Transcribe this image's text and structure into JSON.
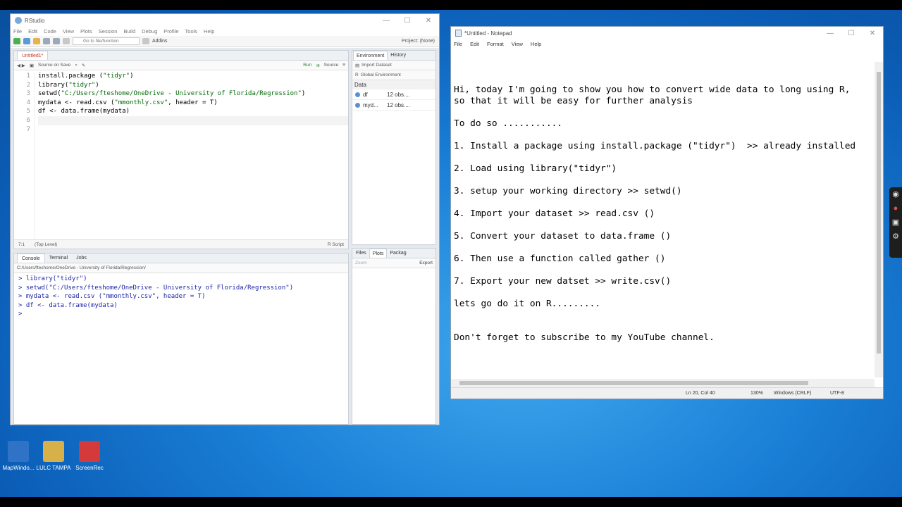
{
  "desktop": {
    "icons": [
      {
        "label": "MapWindo...",
        "color": "#2f73c7"
      },
      {
        "label": "LULC TAMPA",
        "color": "#d8b04a"
      },
      {
        "label": "ScreenRec",
        "color": "#d53a3a"
      }
    ]
  },
  "rstudio": {
    "title": "RStudio",
    "menu": [
      "File",
      "Edit",
      "Code",
      "View",
      "Plots",
      "Session",
      "Build",
      "Debug",
      "Profile",
      "Tools",
      "Help"
    ],
    "toolbar": {
      "goto": "Go to file/function",
      "addins": "Addins",
      "project": "Project: (None)"
    },
    "source": {
      "tab": "Untitled1*",
      "source_on_save": "Source on Save",
      "run": "Run",
      "source_btn": "Source",
      "line_numbers": [
        "1",
        "2",
        "3",
        "4",
        "5",
        "6",
        "7"
      ],
      "lines": [
        {
          "a": "install.package (",
          "s": "\"tidyr\"",
          "b": ")"
        },
        {
          "a": "library(",
          "s": "\"tidyr\"",
          "b": ")"
        },
        {
          "a": "setwd(",
          "s": "\"C:/Users/fteshome/OneDrive - University of Florida/Regression\"",
          "b": ")"
        },
        {
          "a": "mydata <- read.csv (",
          "s": "\"mmonthly.csv\"",
          "b": ", header = T)"
        },
        {
          "a": "df <- data.frame(mydata)",
          "s": "",
          "b": ""
        },
        {
          "a": "",
          "s": "",
          "b": ""
        },
        {
          "a": "",
          "s": "",
          "b": ""
        }
      ],
      "cursor_pos": "7:1",
      "scope": "(Top Level)",
      "filetype": "R Script"
    },
    "console": {
      "tabs": [
        "Console",
        "Terminal",
        "Jobs"
      ],
      "path": "C:/Users/fteshome/OneDrive - University of Florida/Regression/",
      "lines": [
        "> library(\"tidyr\")",
        "> setwd(\"C:/Users/fteshome/OneDrive - University of Florida/Regression\")",
        "> mydata <- read.csv (\"mmonthly.csv\", header = T)",
        "> df <- data.frame(mydata)",
        "> "
      ]
    },
    "environment": {
      "tabs": [
        "Environment",
        "History"
      ],
      "import": "Import Dataset",
      "lang": "R",
      "scope": "Global Environment",
      "section": "Data",
      "rows": [
        {
          "name": "df",
          "value": "12 obs...."
        },
        {
          "name": "myd...",
          "value": "12 obs...."
        }
      ]
    },
    "files": {
      "tabs": [
        "Files",
        "Plots",
        "Packag"
      ],
      "zoom": "Zoom",
      "export": "Export"
    }
  },
  "notepad": {
    "title": "*Untitled - Notepad",
    "menu": [
      "File",
      "Edit",
      "Format",
      "View",
      "Help"
    ],
    "lines": [
      "",
      "",
      "Hi, today I'm going to show you how to convert wide data to long using R,",
      "so that it will be easy for further analysis",
      "",
      "To do so ...........",
      "",
      "1. Install a package using install.package (\"tidyr\")  >> already installed",
      "",
      "2. Load using library(\"tidyr\")",
      "",
      "3. setup your working directory >> setwd()",
      "",
      "4. Import your dataset >> read.csv ()",
      "",
      "5. Convert your dataset to data.frame ()",
      "",
      "6. Then use a function called gather ()",
      "",
      "7. Export your new datset >> write.csv()",
      "",
      "lets go do it on R.........",
      "",
      "",
      "Don't forget to subscribe to my YouTube channel."
    ],
    "status": {
      "pos": "Ln 20, Col 40",
      "zoom": "130%",
      "eol": "Windows (CRLF)",
      "enc": "UTF-8"
    }
  }
}
